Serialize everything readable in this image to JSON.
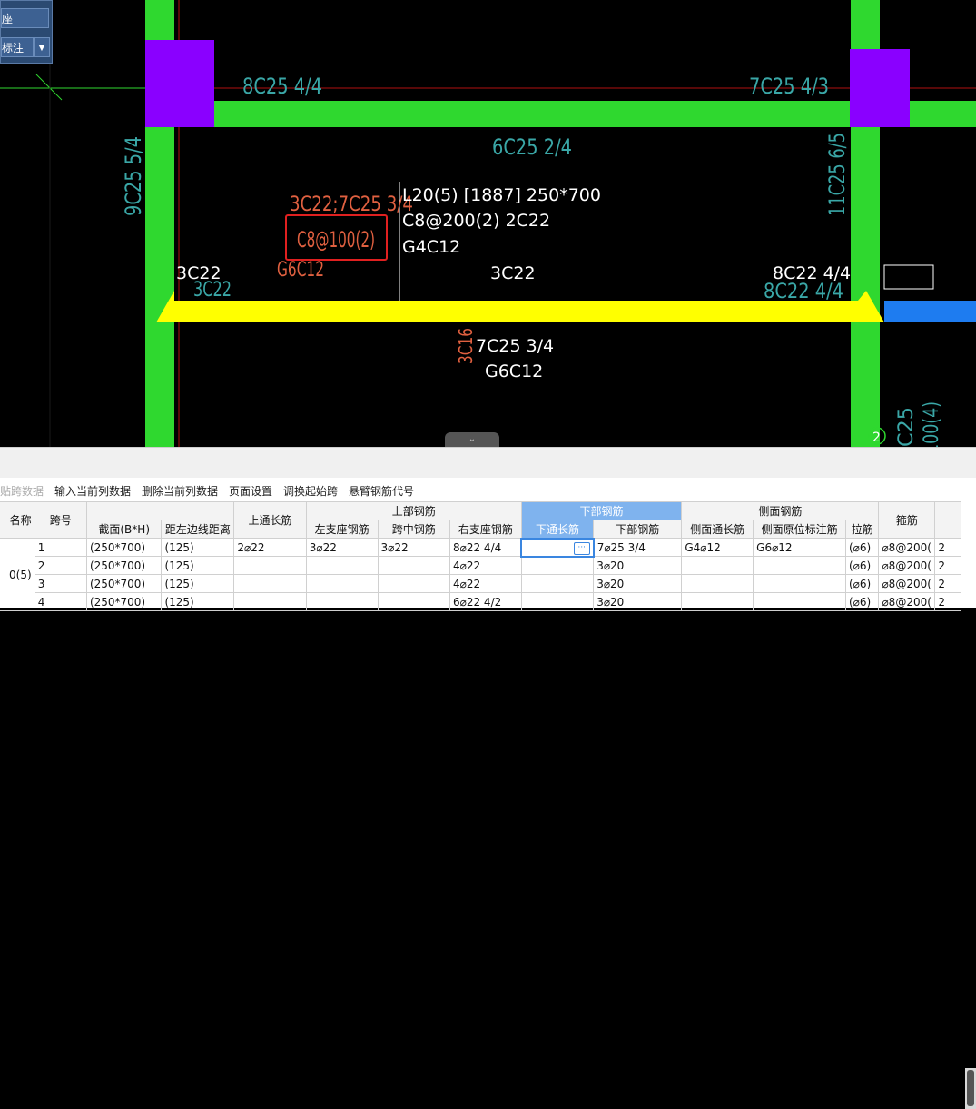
{
  "floating_panel": {
    "btn1_label": "座",
    "btn2_label": "标注",
    "dropdown_glyph": "▼"
  },
  "cad": {
    "top_left_label": "8C25 4/4",
    "top_right_label": "7C25 4/3",
    "beam_middle_label": "6C25 2/4",
    "col_left_vertical": "9C25 5/4",
    "col_right_vertical": "11C25 6/5",
    "red_label_1": "3C22;7C25 3/4",
    "red_label_boxed": "C8@100(2)",
    "red_label_g": "G6C12",
    "beam_info_line1": "L20(5) [1887] 250*700",
    "beam_info_line2": "C8@200(2) 2C22",
    "beam_info_line3": "G4C12",
    "left_support_white": "3C22",
    "left_support_cyan": "3C22",
    "mid_support_white": "3C22",
    "right_support_white": "8C22 4/4",
    "right_support_cyan": "8C22 4/4",
    "bottom_red_vertical": "3C16",
    "bottom_line1": "7C25 3/4",
    "bottom_line2": "G6C12",
    "bottom_right_vertical": "C25",
    "bottom_right_vertical2": "100(4)",
    "circle_marker": "2",
    "collapse_glyph": "⌄"
  },
  "toolbar": {
    "paste": "贴跨数据",
    "input_col": "输入当前列数据",
    "delete_col": "删除当前列数据",
    "page_setup": "页面设置",
    "swap_start": "调换起始跨",
    "cantilever": "悬臂钢筋代号"
  },
  "table": {
    "headers": {
      "name": "名称",
      "span_no": "跨号",
      "top_group": "上部钢筋",
      "bottom_group": "下部钢筋",
      "side_group": "侧面钢筋",
      "stirrup": "箍筋",
      "section": "截面(B*H)",
      "left_dist": "距左边线距离",
      "top_through": "上通长筋",
      "left_support": "左支座钢筋",
      "mid_span": "跨中钢筋",
      "right_support": "右支座钢筋",
      "bottom_through": "下通长筋",
      "bottom_bars": "下部钢筋",
      "side_through": "侧面通长筋",
      "side_in_situ": "侧面原位标注筋",
      "tie_bar": "拉筋"
    },
    "name_value": "0(5)",
    "rows": [
      {
        "span": "1",
        "section": "(250*700)",
        "dist": "(125)",
        "top_through": "2⌀22",
        "left_support": "3⌀22",
        "mid": "3⌀22",
        "right_support": "8⌀22 4/4",
        "bottom_through": "",
        "bottom": "7⌀25 3/4",
        "side_through": "G4⌀12",
        "side_in_situ": "G6⌀12",
        "tie": "(⌀6)",
        "stirrup": "⌀8@200(",
        "extra": "2"
      },
      {
        "span": "2",
        "section": "(250*700)",
        "dist": "(125)",
        "top_through": "",
        "left_support": "",
        "mid": "",
        "right_support": "4⌀22",
        "bottom_through": "",
        "bottom": "3⌀20",
        "side_through": "",
        "side_in_situ": "",
        "tie": "(⌀6)",
        "stirrup": "⌀8@200(",
        "extra": "2"
      },
      {
        "span": "3",
        "section": "(250*700)",
        "dist": "(125)",
        "top_through": "",
        "left_support": "",
        "mid": "",
        "right_support": "4⌀22",
        "bottom_through": "",
        "bottom": "3⌀20",
        "side_through": "",
        "side_in_situ": "",
        "tie": "(⌀6)",
        "stirrup": "⌀8@200(",
        "extra": "2"
      },
      {
        "span": "4",
        "section": "(250*700)",
        "dist": "(125)",
        "top_through": "",
        "left_support": "",
        "mid": "",
        "right_support": "6⌀22 4/2",
        "bottom_through": "",
        "bottom": "3⌀20",
        "side_through": "",
        "side_in_situ": "",
        "tie": "(⌀6)",
        "stirrup": "⌀8@200(",
        "extra": "2"
      }
    ],
    "ellipsis": "···"
  },
  "colors": {
    "column_green": "#2fd82f",
    "column_purple": "#8a00ff",
    "beam_yellow": "#ffff00",
    "cyan_text": "#3aa7a7",
    "red_text": "#e06040",
    "grid_red": "#b01010"
  }
}
